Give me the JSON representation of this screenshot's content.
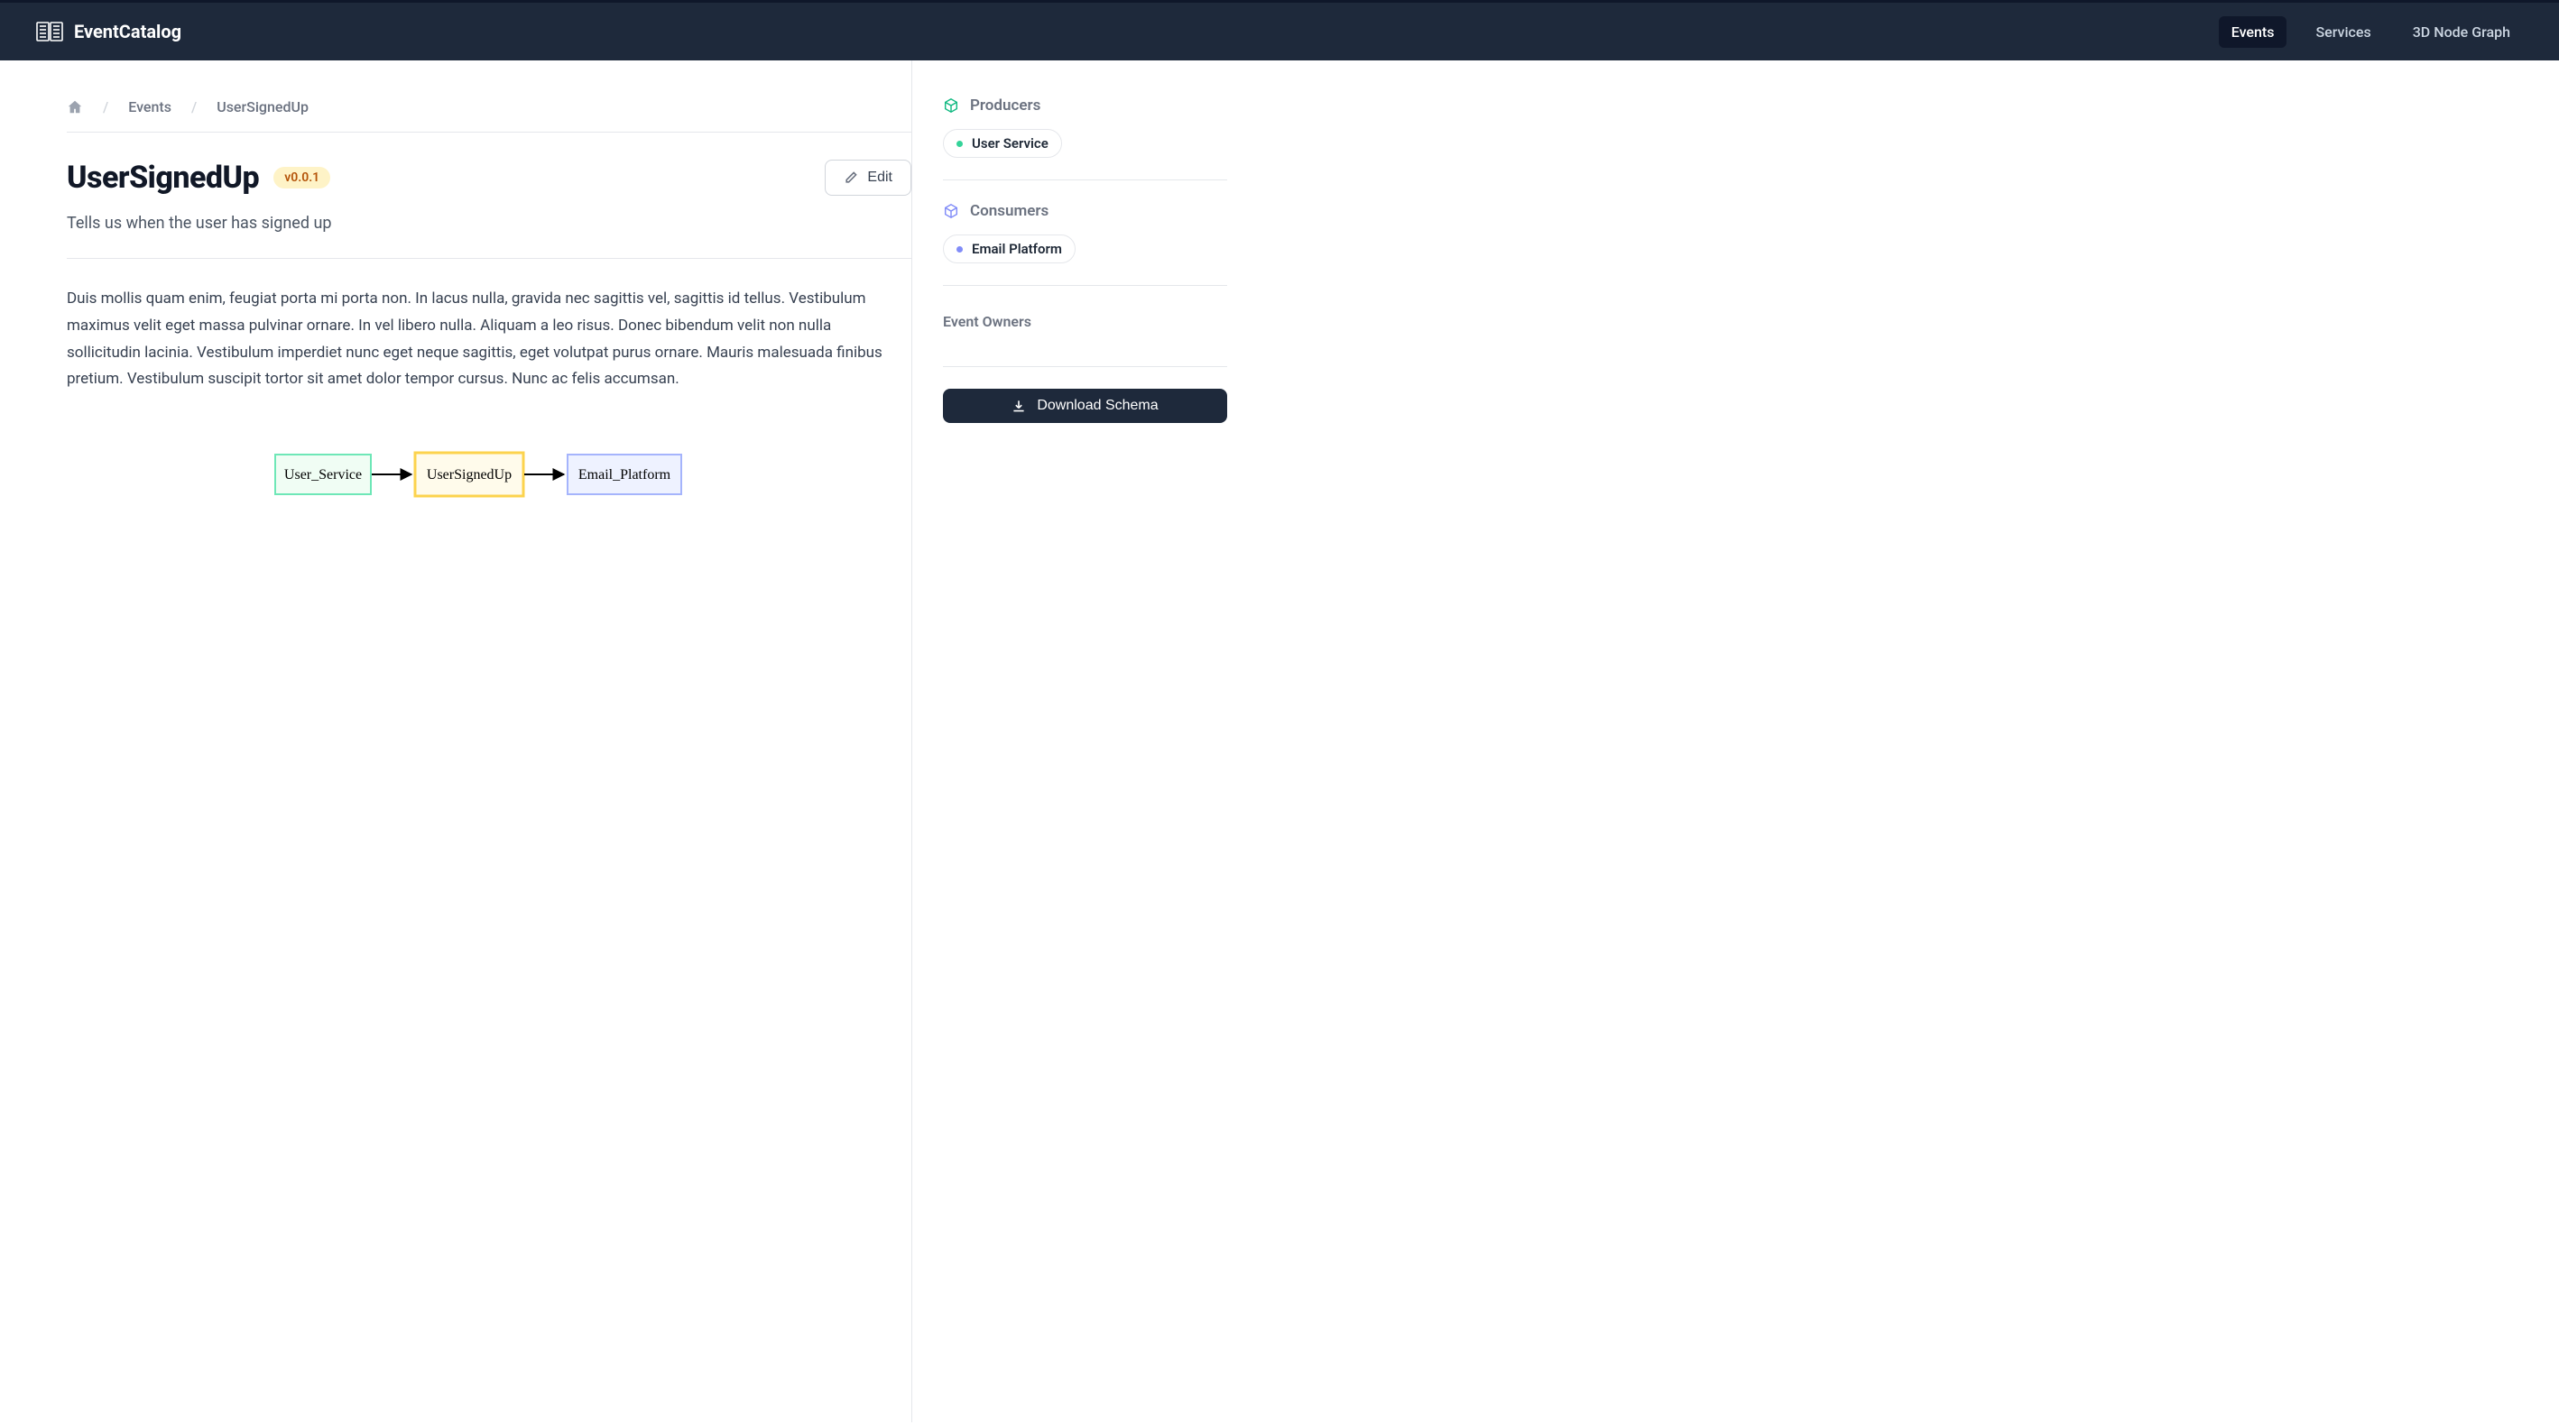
{
  "brand": {
    "title": "EventCatalog"
  },
  "nav": {
    "events": "Events",
    "services": "Services",
    "graph": "3D Node Graph"
  },
  "breadcrumb": {
    "home": "Home",
    "events": "Events",
    "current": "UserSignedUp"
  },
  "page": {
    "title": "UserSignedUp",
    "version": "v0.0.1",
    "edit_label": "Edit",
    "subtitle": "Tells us when the user has signed up",
    "body": "Duis mollis quam enim, feugiat porta mi porta non. In lacus nulla, gravida nec sagittis vel, sagittis id tellus. Vestibulum maximus velit eget massa pulvinar ornare. In vel libero nulla. Aliquam a leo risus. Donec bibendum velit non nulla sollicitudin lacinia. Vestibulum imperdiet nunc eget neque sagittis, eget volutpat purus ornare. Mauris malesuada finibus pretium. Vestibulum suscipit tortor sit amet dolor tempor cursus. Nunc ac felis accumsan."
  },
  "diagram": {
    "producer": "User_Service",
    "event": "UserSignedUp",
    "consumer": "Email_Platform"
  },
  "sidebar": {
    "producers_heading": "Producers",
    "producers": [
      {
        "label": "User Service"
      }
    ],
    "consumers_heading": "Consumers",
    "consumers": [
      {
        "label": "Email Platform"
      }
    ],
    "owners_heading": "Event Owners",
    "download_label": "Download Schema"
  }
}
